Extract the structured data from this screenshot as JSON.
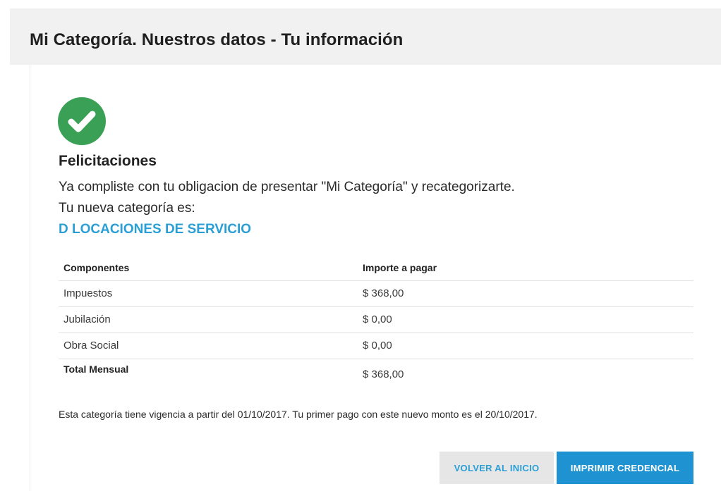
{
  "header": {
    "title": "Mi Categoría. Nuestros datos - Tu información"
  },
  "status": {
    "icon": "check-circle-icon",
    "color": "#3aa055"
  },
  "content": {
    "heading": "Felicitaciones",
    "message": "Ya compliste con tu obligacion de presentar \"Mi Categoría\" y recategorizarte.",
    "category_label": "Tu nueva categoría es:",
    "category_value": "D LOCACIONES DE SERVICIO",
    "accent_color": "#2a9fd6"
  },
  "table": {
    "headers": [
      "Componentes",
      "Importe a pagar"
    ],
    "rows": [
      [
        "Impuestos",
        "$ 368,00"
      ],
      [
        "Jubilación",
        "$ 0,00"
      ],
      [
        "Obra Social",
        "$ 0,00"
      ]
    ],
    "total": [
      "Total Mensual",
      "$ 368,00"
    ]
  },
  "footer": {
    "note": "Esta categoría tiene vigencia a partir del 01/10/2017. Tu primer pago con este nuevo monto es el 20/10/2017."
  },
  "actions": {
    "back_label": "VOLVER AL INICIO",
    "print_label": "IMPRIMIR CREDENCIAL"
  }
}
